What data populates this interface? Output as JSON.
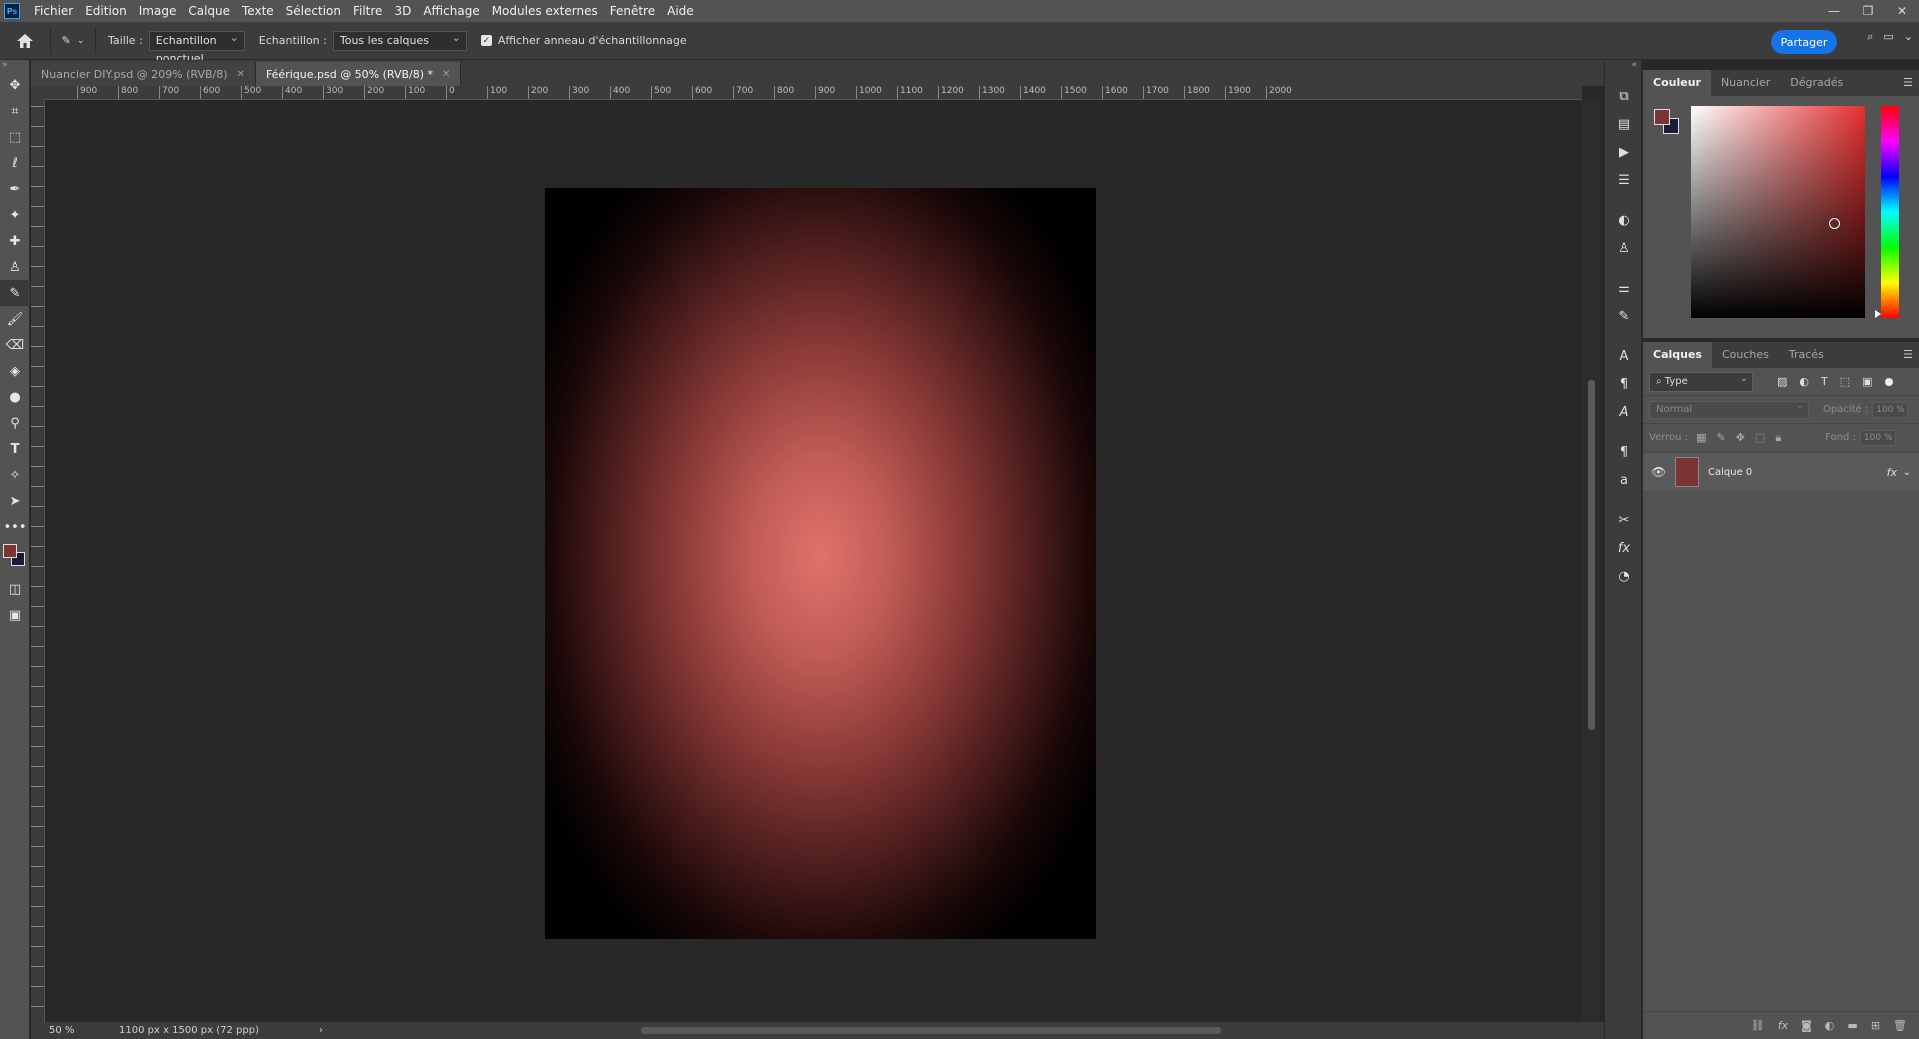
{
  "app": {
    "logo": "Ps",
    "menu": [
      "Fichier",
      "Edition",
      "Image",
      "Calque",
      "Texte",
      "Sélection",
      "Filtre",
      "3D",
      "Affichage",
      "Modules externes",
      "Fenêtre",
      "Aide"
    ],
    "window_controls": [
      "—",
      "❐",
      "✕"
    ]
  },
  "options_bar": {
    "size_label": "Taille :",
    "size_value": "Echantillon ponctuel",
    "sample_label": "Echantillon :",
    "sample_value": "Tous les calques",
    "ring_label": "Afficher anneau d'échantillonnage",
    "ring_checked": true,
    "share_label": "Partager"
  },
  "tabs": [
    {
      "label": "Nuancier DIY.psd @ 209% (RVB/8)",
      "active": false
    },
    {
      "label": "Féérique.psd @ 50% (RVB/8) *",
      "active": true
    }
  ],
  "ruler_h": [
    "900",
    "800",
    "700",
    "600",
    "500",
    "400",
    "300",
    "200",
    "100",
    "0",
    "100",
    "200",
    "300",
    "400",
    "500",
    "600",
    "700",
    "800",
    "900",
    "1000",
    "1100",
    "1200",
    "1300",
    "1400",
    "1500",
    "1600",
    "1700",
    "1800",
    "1900",
    "2000"
  ],
  "status": {
    "zoom": "50 %",
    "doc_info": "1100 px x 1500 px (72 ppp)"
  },
  "color_panel": {
    "tabs": [
      "Couleur",
      "Nuancier",
      "Dégradés"
    ],
    "foreground": "#7b3535",
    "background": "#1c1c3a"
  },
  "layers_panel": {
    "tabs": [
      "Calques",
      "Couches",
      "Tracés"
    ],
    "filter_type": "Type",
    "blend_mode": "Normal",
    "opacity_label": "Opacité :",
    "opacity_value": "100 %",
    "lock_label": "Verrou :",
    "fill_label": "Fond :",
    "fill_value": "100 %",
    "layers": [
      {
        "name": "Calque 0",
        "visible": true,
        "thumb_color": "#7b3535"
      }
    ]
  }
}
